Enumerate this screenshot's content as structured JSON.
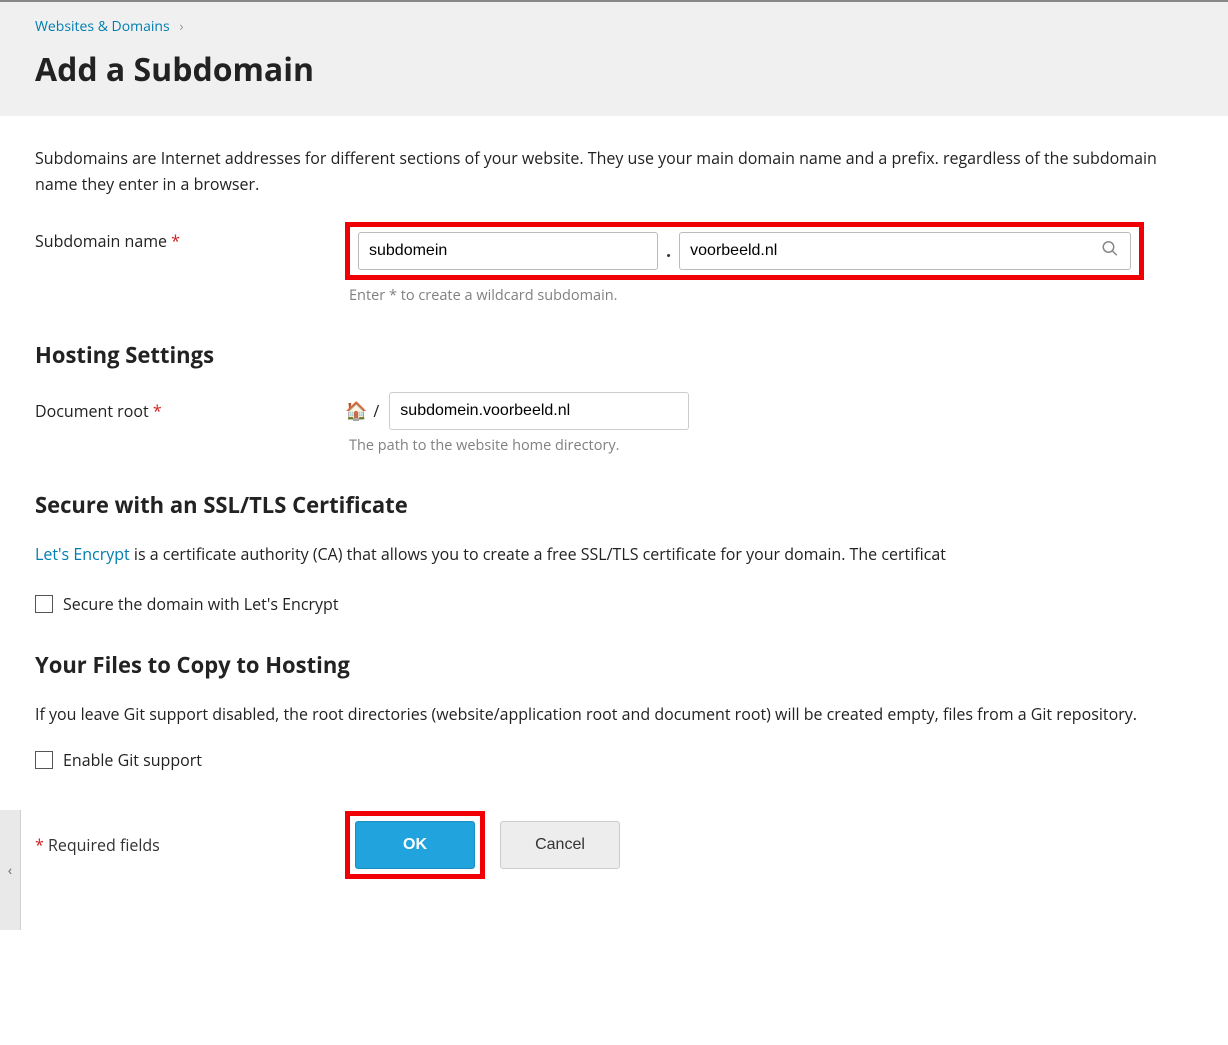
{
  "breadcrumb": {
    "link": "Websites & Domains"
  },
  "page_title": "Add a Subdomain",
  "intro": "Subdomains are Internet addresses for different sections of your website. They use your main domain name and a prefix. regardless of the subdomain name they enter in a browser.",
  "subdomain": {
    "label": "Subdomain name",
    "value": "subdomein",
    "domain_value": "voorbeeld.nl",
    "hint": "Enter * to create a wildcard subdomain."
  },
  "hosting": {
    "heading": "Hosting Settings",
    "docroot_label": "Document root",
    "docroot_value": "subdomein.voorbeeld.nl",
    "docroot_hint": "The path to the website home directory.",
    "slash": "/"
  },
  "ssl": {
    "heading": "Secure with an SSL/TLS Certificate",
    "link_text": "Let's Encrypt",
    "text_after": " is a certificate authority (CA) that allows you to create a free SSL/TLS certificate for your domain. The certificat",
    "checkbox_label": "Secure the domain with Let's Encrypt"
  },
  "files": {
    "heading": "Your Files to Copy to Hosting",
    "text": "If you leave Git support disabled, the root directories (website/application root and document root) will be created empty, files from a Git repository.",
    "checkbox_label": "Enable Git support"
  },
  "footer": {
    "required_note": "Required fields",
    "ok_label": "OK",
    "cancel_label": "Cancel"
  },
  "side_collapse_glyph": "‹"
}
